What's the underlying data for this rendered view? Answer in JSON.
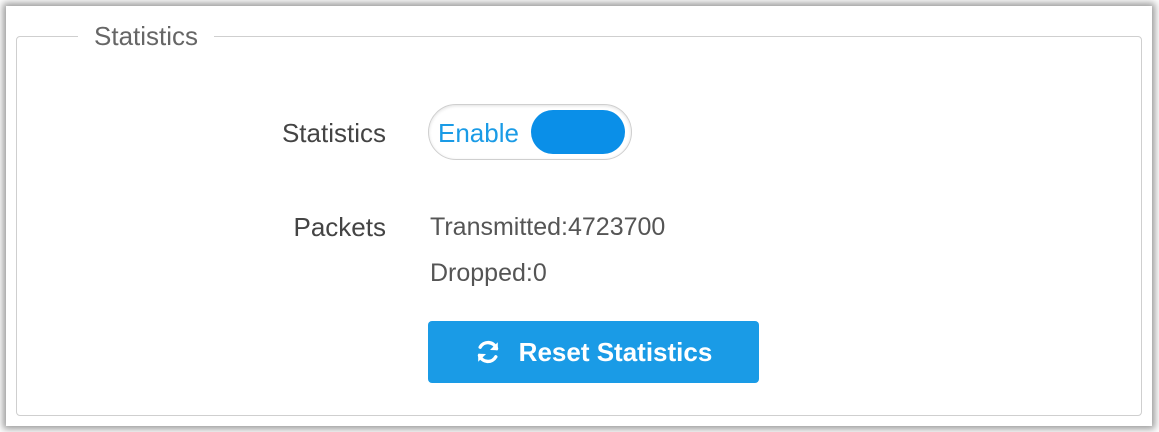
{
  "panel": {
    "legend": "Statistics"
  },
  "statistics_row": {
    "label": "Statistics",
    "toggle": {
      "label": "Enable",
      "state": "on",
      "accent_color": "#0a8fe8"
    }
  },
  "packets_row": {
    "label": "Packets",
    "transmitted": "Transmitted:4723700",
    "dropped": "Dropped:0"
  },
  "actions": {
    "reset_label": "Reset Statistics",
    "reset_icon": "refresh-icon",
    "button_color": "#1a9be6"
  }
}
